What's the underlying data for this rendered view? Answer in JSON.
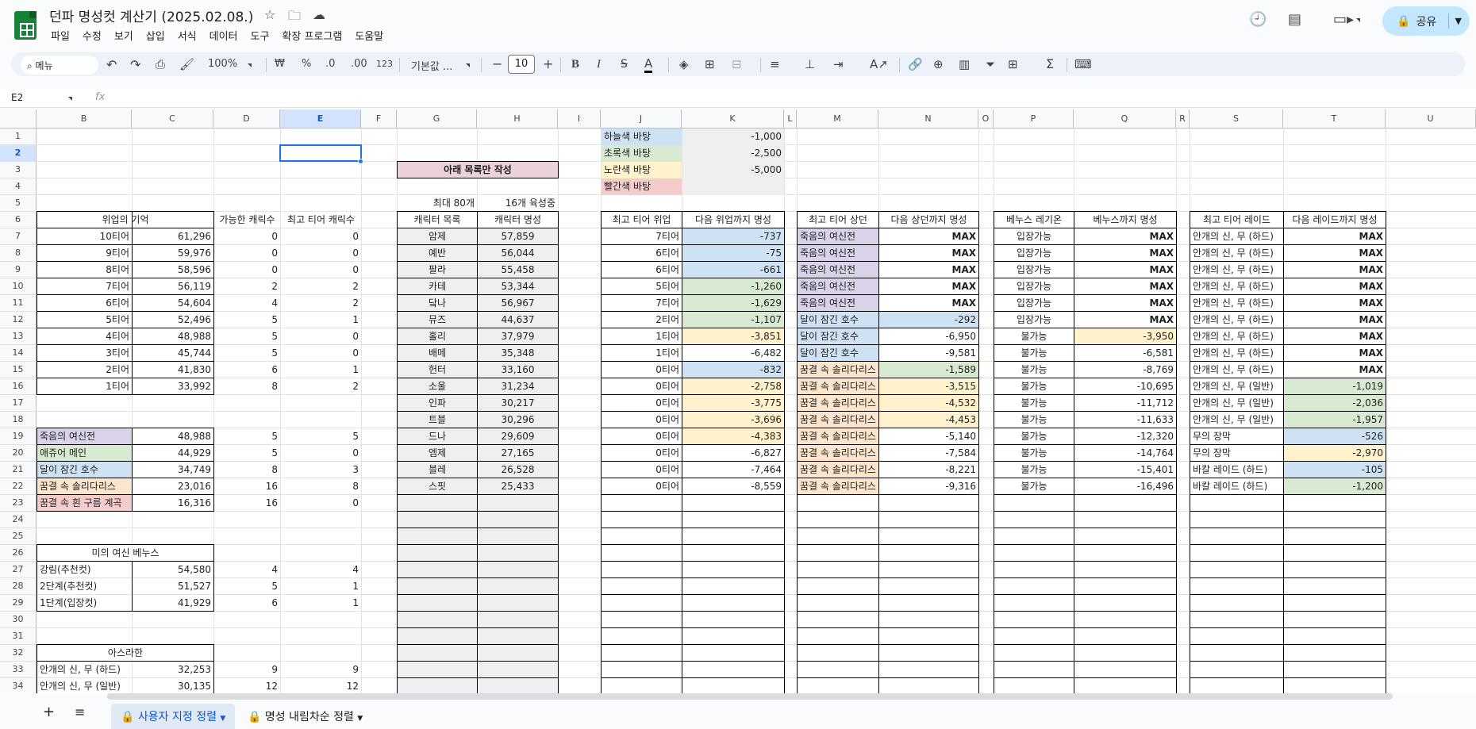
{
  "doc_title": "던파 명성컷 계산기 (2025.02.08.)",
  "menu": [
    "파일",
    "수정",
    "보기",
    "삽입",
    "서식",
    "데이터",
    "도구",
    "확장 프로그램",
    "도움말"
  ],
  "toolbar": {
    "search": "메뉴",
    "zoom": "100%",
    "currency": "₩",
    "percent": "%",
    "dec_less": ".0",
    "dec_more": ".00",
    "num_format": "123",
    "font": "기본값 ...",
    "font_size": "10"
  },
  "share_label": "공유",
  "name_box": "E2",
  "fx": "fx",
  "columns": [
    "B",
    "C",
    "D",
    "E",
    "F",
    "G",
    "H",
    "I",
    "J",
    "K",
    "L",
    "M",
    "N",
    "O",
    "P",
    "Q",
    "R",
    "S",
    "T",
    "U"
  ],
  "rows": [
    "1",
    "2",
    "3",
    "4",
    "5",
    "6",
    "7",
    "8",
    "9",
    "10",
    "11",
    "12",
    "13",
    "14",
    "15",
    "16",
    "17",
    "18",
    "19",
    "20",
    "21",
    "22",
    "23",
    "24",
    "25",
    "26",
    "27",
    "28",
    "29",
    "30",
    "31",
    "32",
    "33",
    "34"
  ],
  "legend": [
    [
      "하늘색 바탕",
      "-1,000"
    ],
    [
      "초록색 바탕",
      "-2,500"
    ],
    [
      "노란색 바탕",
      "-5,000"
    ],
    [
      "빨간색 바탕",
      ""
    ]
  ],
  "notice": "아래 목록만 작성",
  "max80": "최대 80개",
  "grow16": "16개 육성중",
  "memory": {
    "header": "위업의 기억",
    "possible": "가능한 캐릭수",
    "top_tier": "최고 티어 캐릭수",
    "rows": [
      [
        "10티어",
        "61,296",
        "0",
        "0"
      ],
      [
        "9티어",
        "59,976",
        "0",
        "0"
      ],
      [
        "8티어",
        "58,596",
        "0",
        "0"
      ],
      [
        "7티어",
        "56,119",
        "2",
        "2"
      ],
      [
        "6티어",
        "54,604",
        "4",
        "2"
      ],
      [
        "5티어",
        "52,496",
        "5",
        "1"
      ],
      [
        "4티어",
        "48,988",
        "5",
        "0"
      ],
      [
        "3티어",
        "45,744",
        "5",
        "0"
      ],
      [
        "2티어",
        "41,830",
        "6",
        "1"
      ],
      [
        "1티어",
        "33,992",
        "8",
        "2"
      ]
    ]
  },
  "dungeons": [
    [
      "죽음의 여신전",
      "48,988",
      "5",
      "5"
    ],
    [
      "애쥬어 메인",
      "44,929",
      "5",
      "0"
    ],
    [
      "달이 잠긴 호수",
      "34,749",
      "8",
      "3"
    ],
    [
      "꿈결 속 솔리다리스",
      "23,016",
      "16",
      "8"
    ],
    [
      "꿈결 속 흰 구름 계곡",
      "16,316",
      "16",
      "0"
    ]
  ],
  "venus": {
    "header": "미의 여신 베누스",
    "rows": [
      [
        "강림(추천컷)",
        "54,580",
        "4",
        "4"
      ],
      [
        "2단계(추천컷)",
        "51,527",
        "5",
        "1"
      ],
      [
        "1단계(입장컷)",
        "41,929",
        "6",
        "1"
      ]
    ]
  },
  "asrahan": {
    "header": "아스라한",
    "rows": [
      [
        "안개의 신, 무 (하드)",
        "32,253",
        "9",
        "9"
      ],
      [
        "안개의 신, 무 (일반)",
        "30,135",
        "12",
        "12"
      ]
    ]
  },
  "chars": {
    "h1": "캐릭터 목록",
    "h2": "캐릭터 명성",
    "rows": [
      [
        "암제",
        "57,859"
      ],
      [
        "예반",
        "56,044"
      ],
      [
        "팔라",
        "55,458"
      ],
      [
        "카테",
        "53,344"
      ],
      [
        "닼나",
        "56,967"
      ],
      [
        "뮤즈",
        "44,637"
      ],
      [
        "홀리",
        "37,979"
      ],
      [
        "배메",
        "35,348"
      ],
      [
        "헌터",
        "33,160"
      ],
      [
        "소울",
        "31,234"
      ],
      [
        "인파",
        "30,217"
      ],
      [
        "트블",
        "30,296"
      ],
      [
        "드나",
        "29,609"
      ],
      [
        "엠제",
        "27,165"
      ],
      [
        "블레",
        "26,528"
      ],
      [
        "스핏",
        "25,433"
      ]
    ]
  },
  "tier": {
    "h1": "최고 티어 위업",
    "h2": "다음 위업까지 명성",
    "rows": [
      [
        "7티어",
        "-737"
      ],
      [
        "6티어",
        "-75"
      ],
      [
        "6티어",
        "-661"
      ],
      [
        "5티어",
        "-1,260"
      ],
      [
        "7티어",
        "-1,629"
      ],
      [
        "2티어",
        "-1,107"
      ],
      [
        "1티어",
        "-3,851"
      ],
      [
        "1티어",
        "-6,482"
      ],
      [
        "0티어",
        "-832"
      ],
      [
        "0티어",
        "-2,758"
      ],
      [
        "0티어",
        "-3,775"
      ],
      [
        "0티어",
        "-3,696"
      ],
      [
        "0티어",
        "-4,383"
      ],
      [
        "0티어",
        "-6,827"
      ],
      [
        "0티어",
        "-7,464"
      ],
      [
        "0티어",
        "-8,559"
      ]
    ]
  },
  "sangdan": {
    "h1": "최고 티어 상던",
    "h2": "다음 상던까지 명성",
    "rows": [
      [
        "죽음의 여신전",
        "MAX"
      ],
      [
        "죽음의 여신전",
        "MAX"
      ],
      [
        "죽음의 여신전",
        "MAX"
      ],
      [
        "죽음의 여신전",
        "MAX"
      ],
      [
        "죽음의 여신전",
        "MAX"
      ],
      [
        "달이 잠긴 호수",
        "-292"
      ],
      [
        "달이 잠긴 호수",
        "-6,950"
      ],
      [
        "달이 잠긴 호수",
        "-9,581"
      ],
      [
        "꿈결 속 솔리다리스",
        "-1,589"
      ],
      [
        "꿈결 속 솔리다리스",
        "-3,515"
      ],
      [
        "꿈결 속 솔리다리스",
        "-4,532"
      ],
      [
        "꿈결 속 솔리다리스",
        "-4,453"
      ],
      [
        "꿈결 속 솔리다리스",
        "-5,140"
      ],
      [
        "꿈결 속 솔리다리스",
        "-7,584"
      ],
      [
        "꿈결 속 솔리다리스",
        "-8,221"
      ],
      [
        "꿈결 속 솔리다리스",
        "-9,316"
      ]
    ]
  },
  "venus_raid": {
    "h1": "베누스 레기온",
    "h2": "베누스까지 명성",
    "rows": [
      [
        "입장가능",
        "MAX"
      ],
      [
        "입장가능",
        "MAX"
      ],
      [
        "입장가능",
        "MAX"
      ],
      [
        "입장가능",
        "MAX"
      ],
      [
        "입장가능",
        "MAX"
      ],
      [
        "입장가능",
        "MAX"
      ],
      [
        "불가능",
        "-3,950"
      ],
      [
        "불가능",
        "-6,581"
      ],
      [
        "불가능",
        "-8,769"
      ],
      [
        "불가능",
        "-10,695"
      ],
      [
        "불가능",
        "-11,712"
      ],
      [
        "불가능",
        "-11,633"
      ],
      [
        "불가능",
        "-12,320"
      ],
      [
        "불가능",
        "-14,764"
      ],
      [
        "불가능",
        "-15,401"
      ],
      [
        "불가능",
        "-16,496"
      ]
    ]
  },
  "raid": {
    "h1": "최고 티어 레이드",
    "h2": "다음 레이드까지 명성",
    "rows": [
      [
        "안개의 신, 무 (하드)",
        "MAX"
      ],
      [
        "안개의 신, 무 (하드)",
        "MAX"
      ],
      [
        "안개의 신, 무 (하드)",
        "MAX"
      ],
      [
        "안개의 신, 무 (하드)",
        "MAX"
      ],
      [
        "안개의 신, 무 (하드)",
        "MAX"
      ],
      [
        "안개의 신, 무 (하드)",
        "MAX"
      ],
      [
        "안개의 신, 무 (하드)",
        "MAX"
      ],
      [
        "안개의 신, 무 (하드)",
        "MAX"
      ],
      [
        "안개의 신, 무 (하드)",
        "MAX"
      ],
      [
        "안개의 신, 무 (일반)",
        "-1,019"
      ],
      [
        "안개의 신, 무 (일반)",
        "-2,036"
      ],
      [
        "안개의 신, 무 (일반)",
        "-1,957"
      ],
      [
        "무의 장막",
        "-526"
      ],
      [
        "무의 장막",
        "-2,970"
      ],
      [
        "바칼 레이드 (하드)",
        "-105"
      ],
      [
        "바칼 레이드 (하드)",
        "-1,200"
      ]
    ]
  },
  "sheet_tabs": [
    "사용자 지정 정렬",
    "명성 내림차순 정렬"
  ],
  "colors": {
    "accent": "#0b57d0",
    "sky": "#cfe2f3",
    "green": "#d9ead3",
    "yellow": "#fff2cc",
    "red": "#f4cccc",
    "purple": "#d9d2e9"
  }
}
